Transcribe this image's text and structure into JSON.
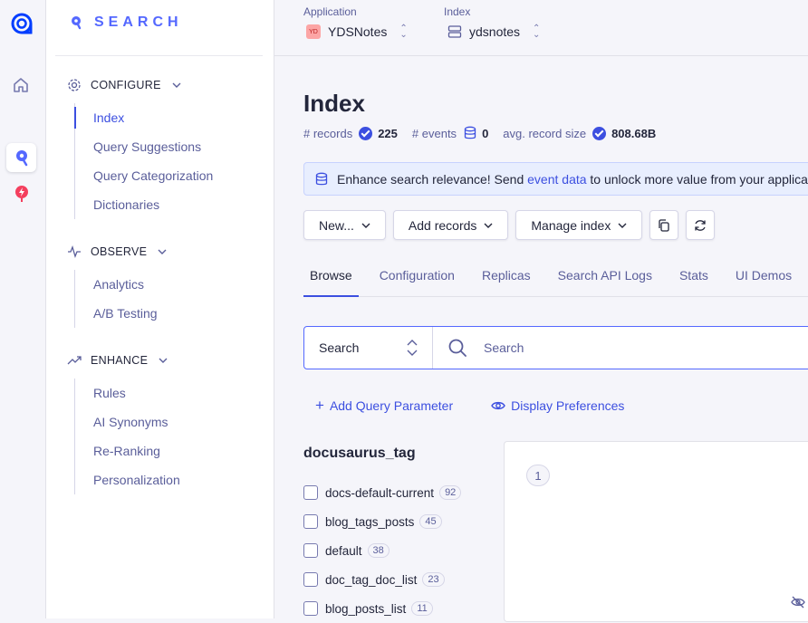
{
  "brand": {
    "name": "SEARCH"
  },
  "sidebar": {
    "sections": [
      {
        "title": "CONFIGURE",
        "items": [
          "Index",
          "Query Suggestions",
          "Query Categorization",
          "Dictionaries"
        ]
      },
      {
        "title": "OBSERVE",
        "items": [
          "Analytics",
          "A/B Testing"
        ]
      },
      {
        "title": "ENHANCE",
        "items": [
          "Rules",
          "AI Synonyms",
          "Re-Ranking",
          "Personalization"
        ]
      }
    ],
    "active_item": "Index"
  },
  "topbar": {
    "application_label": "Application",
    "application_badge": "YD",
    "application_value": "YDSNotes",
    "index_label": "Index",
    "index_value": "ydsnotes"
  },
  "page": {
    "title": "Index",
    "stats": {
      "records_label": "# records",
      "records_value": "225",
      "events_label": "# events",
      "events_value": "0",
      "avg_label": "avg. record size",
      "avg_value": "808.68B"
    }
  },
  "banner": {
    "prefix": "Enhance search relevance! Send ",
    "link": "event data",
    "suffix": " to unlock more value from your applicati"
  },
  "actions": {
    "new_label": "New...",
    "add_records_label": "Add records",
    "manage_index_label": "Manage index"
  },
  "tabs": [
    "Browse",
    "Configuration",
    "Replicas",
    "Search API Logs",
    "Stats",
    "UI Demos"
  ],
  "active_tab": "Browse",
  "search": {
    "mode": "Search",
    "placeholder": "Search"
  },
  "links": {
    "add_query_parameter": "Add Query Parameter",
    "display_preferences": "Display Preferences"
  },
  "facet": {
    "title": "docusaurus_tag",
    "values": [
      {
        "label": "docs-default-current",
        "count": "92"
      },
      {
        "label": "blog_tags_posts",
        "count": "45"
      },
      {
        "label": "default",
        "count": "38"
      },
      {
        "label": "doc_tag_doc_list",
        "count": "23"
      },
      {
        "label": "blog_posts_list",
        "count": "11"
      }
    ]
  },
  "results": {
    "first_hit_number": "1"
  },
  "colors": {
    "accent": "#3c4fe0",
    "brand": "#5468ff",
    "text": "#23263b",
    "muted": "#5a5e9a"
  }
}
